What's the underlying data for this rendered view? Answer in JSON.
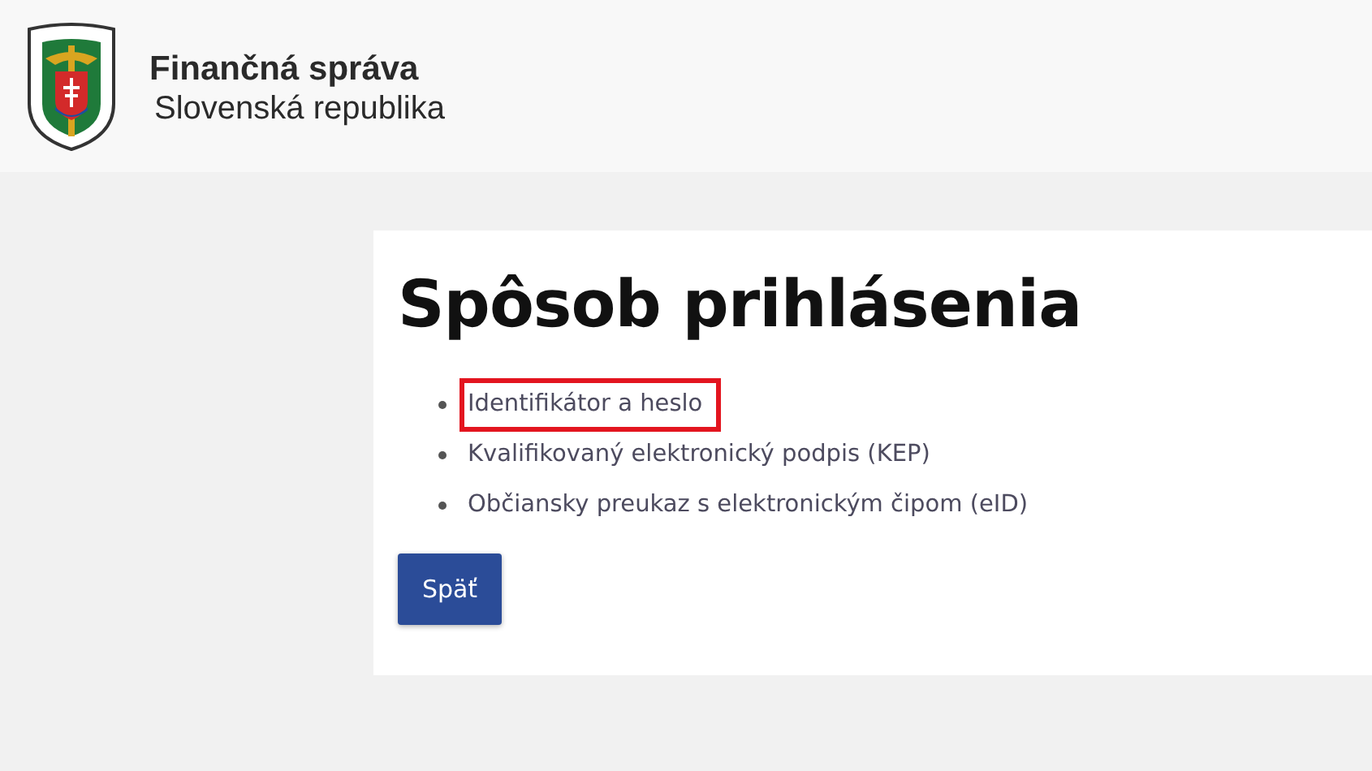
{
  "header": {
    "title": "Finančná správa",
    "subtitle": "Slovenská republika"
  },
  "page": {
    "heading": "Spôsob prihlásenia",
    "options": [
      {
        "label": "Identifikátor a heslo",
        "highlighted": true
      },
      {
        "label": "Kvalifikovaný elektronický podpis (KEP)",
        "highlighted": false
      },
      {
        "label": "Občiansky preukaz s elektronickým čipom (eID)",
        "highlighted": false
      }
    ],
    "back_button": "Späť"
  }
}
